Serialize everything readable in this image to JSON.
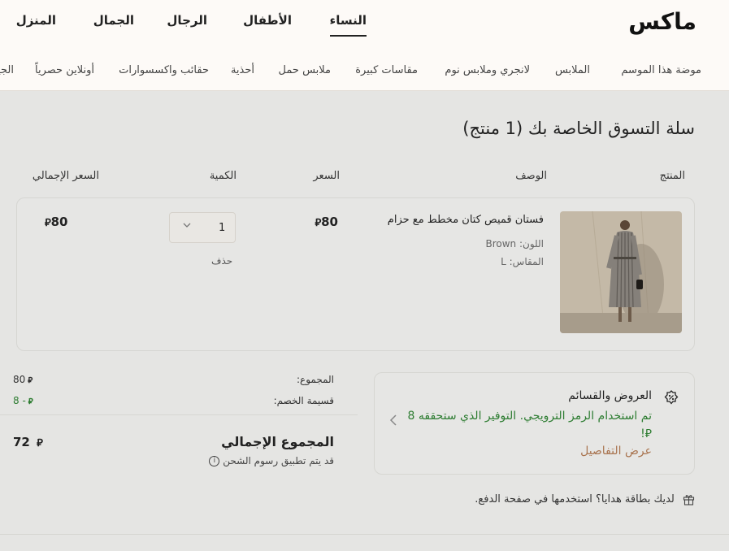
{
  "header": {
    "logo": "ماكس",
    "main_nav": [
      {
        "label": "النساء",
        "active": true
      },
      {
        "label": "الأطفال",
        "active": false
      },
      {
        "label": "الرجال",
        "active": false
      },
      {
        "label": "الجمال",
        "active": false
      },
      {
        "label": "المنزل",
        "active": false
      }
    ],
    "sub_nav": [
      "موضة هذا الموسم",
      "الملابس",
      "لانجري وملابس نوم",
      "مقاسات كبيرة",
      "ملابس حمل",
      "أحذية",
      "حقائب واكسسوارات",
      "أونلاين حصرياً",
      "الجينز"
    ]
  },
  "cart": {
    "title": "سلة التسوق الخاصة بك (1 منتج)",
    "columns": {
      "product": "المنتج",
      "description": "الوصف",
      "price": "السعر",
      "quantity": "الكمية",
      "total": "السعر الإجمالي"
    },
    "item": {
      "image_alt": "فستان قميص كتان مخطط مع حزام",
      "name": "فستان قميص كتان مخطط مع حزام",
      "color_label": "اللون:",
      "color_value": "Brown",
      "size_label": "المقاس:",
      "size_value": "L",
      "price": "80",
      "quantity": "1",
      "delete": "حذف",
      "total": "80"
    },
    "currency_symbol": "⃁"
  },
  "offers": {
    "title": "العروض والقسائم",
    "message": "تم استخدام الرمز الترويجي. التوفير الذي ستحققه 8 ⃁!",
    "details_link": "عرض التفاصيل",
    "icon": "discount-badge-icon"
  },
  "summary": {
    "subtotal_label": "المجموع:",
    "subtotal_value": "80",
    "discount_label": "قسيمة الخصم:",
    "discount_value": "- 8",
    "grand_label": "المجموع الإجمالي",
    "grand_value": "72",
    "shipping_note": "قد يتم تطبيق رسوم الشحن"
  },
  "gift": {
    "text": "لديك بطاقة هدايا؟ استخدمها في صفحة الدفع."
  },
  "colors": {
    "accent_green": "#2e7d32",
    "link_brown": "#a9744f",
    "header_bg": "#fdfaf7",
    "overlay_bg": "#e5e5e3"
  }
}
